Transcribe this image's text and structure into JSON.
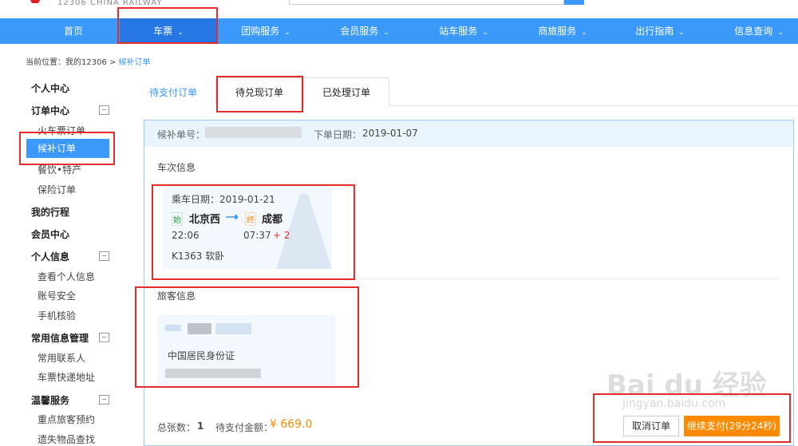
{
  "header": {
    "logo_text": "12306 CHINA RAILWAY"
  },
  "nav": {
    "items": [
      {
        "label": "首页"
      },
      {
        "label": "车票",
        "chev": "⌄"
      },
      {
        "label": "团购服务",
        "chev": "⌄"
      },
      {
        "label": "会员服务",
        "chev": "⌄"
      },
      {
        "label": "站车服务",
        "chev": "⌄"
      },
      {
        "label": "商旅服务",
        "chev": "⌄"
      },
      {
        "label": "出行指南",
        "chev": "⌄"
      },
      {
        "label": "信息查询",
        "chev": "⌄"
      }
    ]
  },
  "breadcrumb": {
    "prefix": "当前位置：我的12306 > ",
    "current": "候补订单"
  },
  "sidebar": {
    "personal_center": "个人中心",
    "order_center": "订单中心",
    "train_orders": "火车票订单",
    "waitlist_orders": "候补订单",
    "catering": "餐饮•特产",
    "insurance": "保险订单",
    "my_trips": "我的行程",
    "member_center": "会员中心",
    "personal_info": "个人信息",
    "view_info": "查看个人信息",
    "account_security": "账号安全",
    "phone_verify": "手机核验",
    "common_info": "常用信息管理",
    "contacts": "常用联系人",
    "delivery_address": "车票快递地址",
    "warm_service": "温馨服务",
    "key_passenger": "重点旅客预约",
    "lost_items": "遗失物品查找",
    "toggle": "−"
  },
  "tabs": [
    {
      "label": "待支付订单"
    },
    {
      "label": "待兑现订单"
    },
    {
      "label": "已处理订单"
    }
  ],
  "order": {
    "no_label": "候补单号：",
    "date_label": "下单日期：",
    "date_value": "2019-01-07",
    "train_section": "车次信息",
    "ride_date": "乘车日期：2019-01-21",
    "start_tag": "始",
    "from_station": "北京西",
    "end_tag": "终",
    "to_station": "成都",
    "depart_time": "22:06",
    "arrive_time": "07:37",
    "day_offset": "+ 2",
    "train_info": "K1363 软卧",
    "passenger_section": "旅客信息",
    "id_type": "中国居民身份证",
    "total_label": "总张数：",
    "total_value": "1",
    "amount_label": "待支付金额：",
    "amount_value": "¥ 669.0",
    "cancel_label": "取消订单",
    "pay_label": "继续支付(29分24秒)"
  },
  "watermark": {
    "main": "Bai du 经验",
    "sub": "jingyan.baidu.com"
  },
  "colors": {
    "brand_blue": "#3b99fc",
    "active_nav": "#2676e3",
    "pay_orange": "#ff8a00",
    "annotation_red": "#e52c2c",
    "price_orange": "#ff8a00"
  }
}
